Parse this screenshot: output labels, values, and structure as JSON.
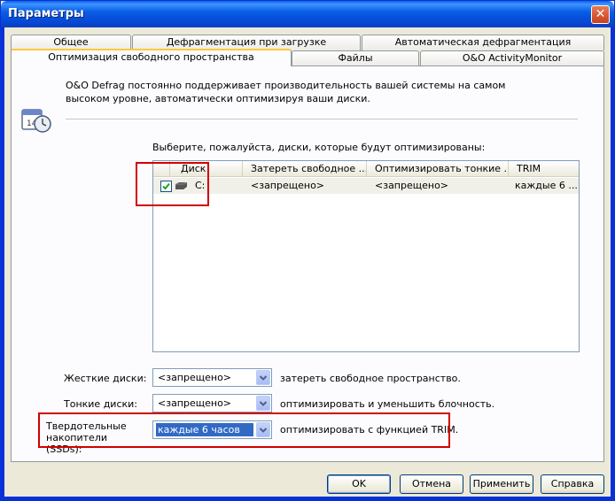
{
  "window": {
    "title": "Параметры",
    "close_glyph": "✕"
  },
  "tabs_row1": [
    {
      "label": "Общее"
    },
    {
      "label": "Дефрагментация при загрузке"
    },
    {
      "label": "Автоматическая дефрагментация"
    }
  ],
  "tabs_row2": [
    {
      "label": "Оптимизация свободного пространства",
      "active": true
    },
    {
      "label": "Файлы"
    },
    {
      "label": "O&O ActivityMonitor"
    }
  ],
  "panel": {
    "description": "O&O Defrag постоянно поддерживает производительность вашей системы на самом высоком уровне, автоматически оптимизируя ваши диски.",
    "select_prompt": "Выберите, пожалуйста, диски, которые будут оптимизированы:",
    "calendar_icon_day": "14"
  },
  "disk_list": {
    "columns": [
      "Диск",
      "Затереть свободное ...",
      "Оптимизировать тонкие ...",
      "TRIM"
    ],
    "rows": [
      {
        "checked": true,
        "disk": "C:",
        "wipe": "<запрещено>",
        "thin": "<запрещено>",
        "trim": "каждые 6 ..."
      }
    ]
  },
  "settings": {
    "hdd": {
      "label": "Жесткие диски:",
      "value": "<запрещено>",
      "desc": "затереть свободное пространство."
    },
    "thin": {
      "label": "Тонкие диски:",
      "value": "<запрещено>",
      "desc": "оптимизировать и уменьшить блочность."
    },
    "ssd": {
      "label": "Твердотельные накопители (SSDs):",
      "value": "каждые 6 часов",
      "desc": "оптимизировать с функцией TRIM."
    }
  },
  "buttons": {
    "ok": "OK",
    "cancel": "Отмена",
    "apply": "Применить",
    "help": "Справка"
  },
  "colors": {
    "highlight_box": "#d20000",
    "selection": "#316ac5",
    "title_bar": "#0a5ee6"
  }
}
